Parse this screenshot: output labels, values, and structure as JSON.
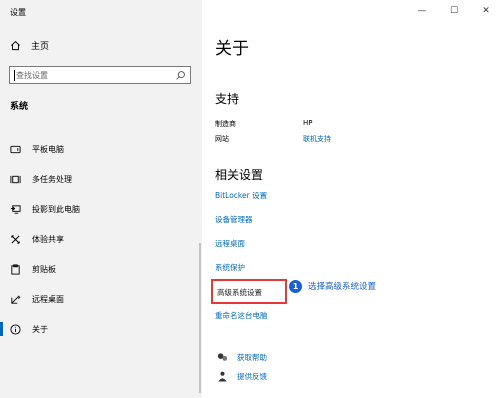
{
  "window": {
    "title": "设置",
    "minimize": "—",
    "maximize": "☐",
    "close": "✕"
  },
  "sidebar": {
    "home_label": "主页",
    "search_placeholder": "查找设置",
    "section_title": "系统",
    "items": [
      {
        "label": "平板电脑",
        "icon": "tablet-icon"
      },
      {
        "label": "多任务处理",
        "icon": "multitasking-icon"
      },
      {
        "label": "投影到此电脑",
        "icon": "project-icon"
      },
      {
        "label": "体验共享",
        "icon": "shared-experiences-icon"
      },
      {
        "label": "剪贴板",
        "icon": "clipboard-icon"
      },
      {
        "label": "远程桌面",
        "icon": "remote-desktop-icon"
      },
      {
        "label": "关于",
        "icon": "info-icon",
        "active": true
      }
    ]
  },
  "content": {
    "title": "关于",
    "support": {
      "heading": "支持",
      "manufacturer_label": "制造商",
      "manufacturer_value": "HP",
      "website_label": "网站",
      "website_value": "联机支持"
    },
    "related": {
      "heading": "相关设置",
      "bitlocker": "BitLocker 设置",
      "device_manager": "设备管理器",
      "remote_desktop": "远程桌面",
      "system_protection": "系统保护",
      "advanced_settings": "高级系统设置",
      "rename_pc": "重命名这台电脑"
    },
    "callout": {
      "step": "1",
      "label": "选择高级系统设置"
    },
    "help": {
      "get_help": "获取帮助",
      "feedback": "提供反馈"
    }
  },
  "colors": {
    "accent": "#0067c0",
    "sidebar_bg": "#f2f2f2",
    "highlight": "#e53935",
    "callout": "#1a5fd0"
  }
}
